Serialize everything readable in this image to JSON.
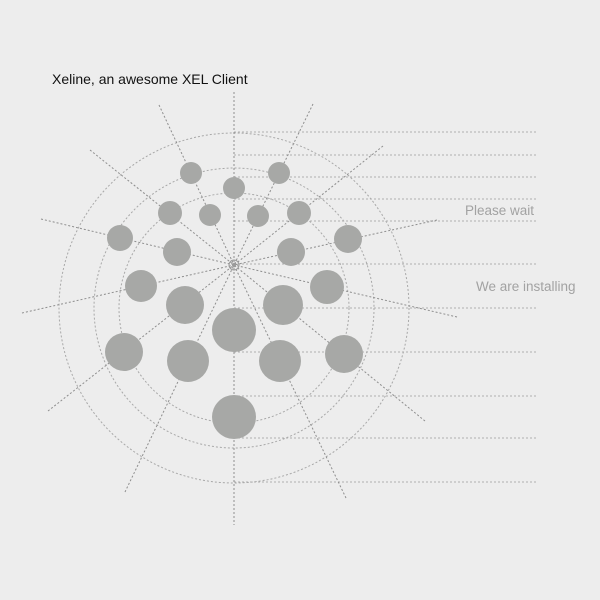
{
  "app": {
    "title": "Xeline, an awesome XEL Client"
  },
  "status": {
    "line1": "Please wait",
    "line2": "We are installing"
  },
  "colors": {
    "background": "#ededed",
    "dots": "#a7a8a6",
    "lines": "#a0a0a0",
    "status_text": "#a2a2a2",
    "title_text": "#111111"
  }
}
